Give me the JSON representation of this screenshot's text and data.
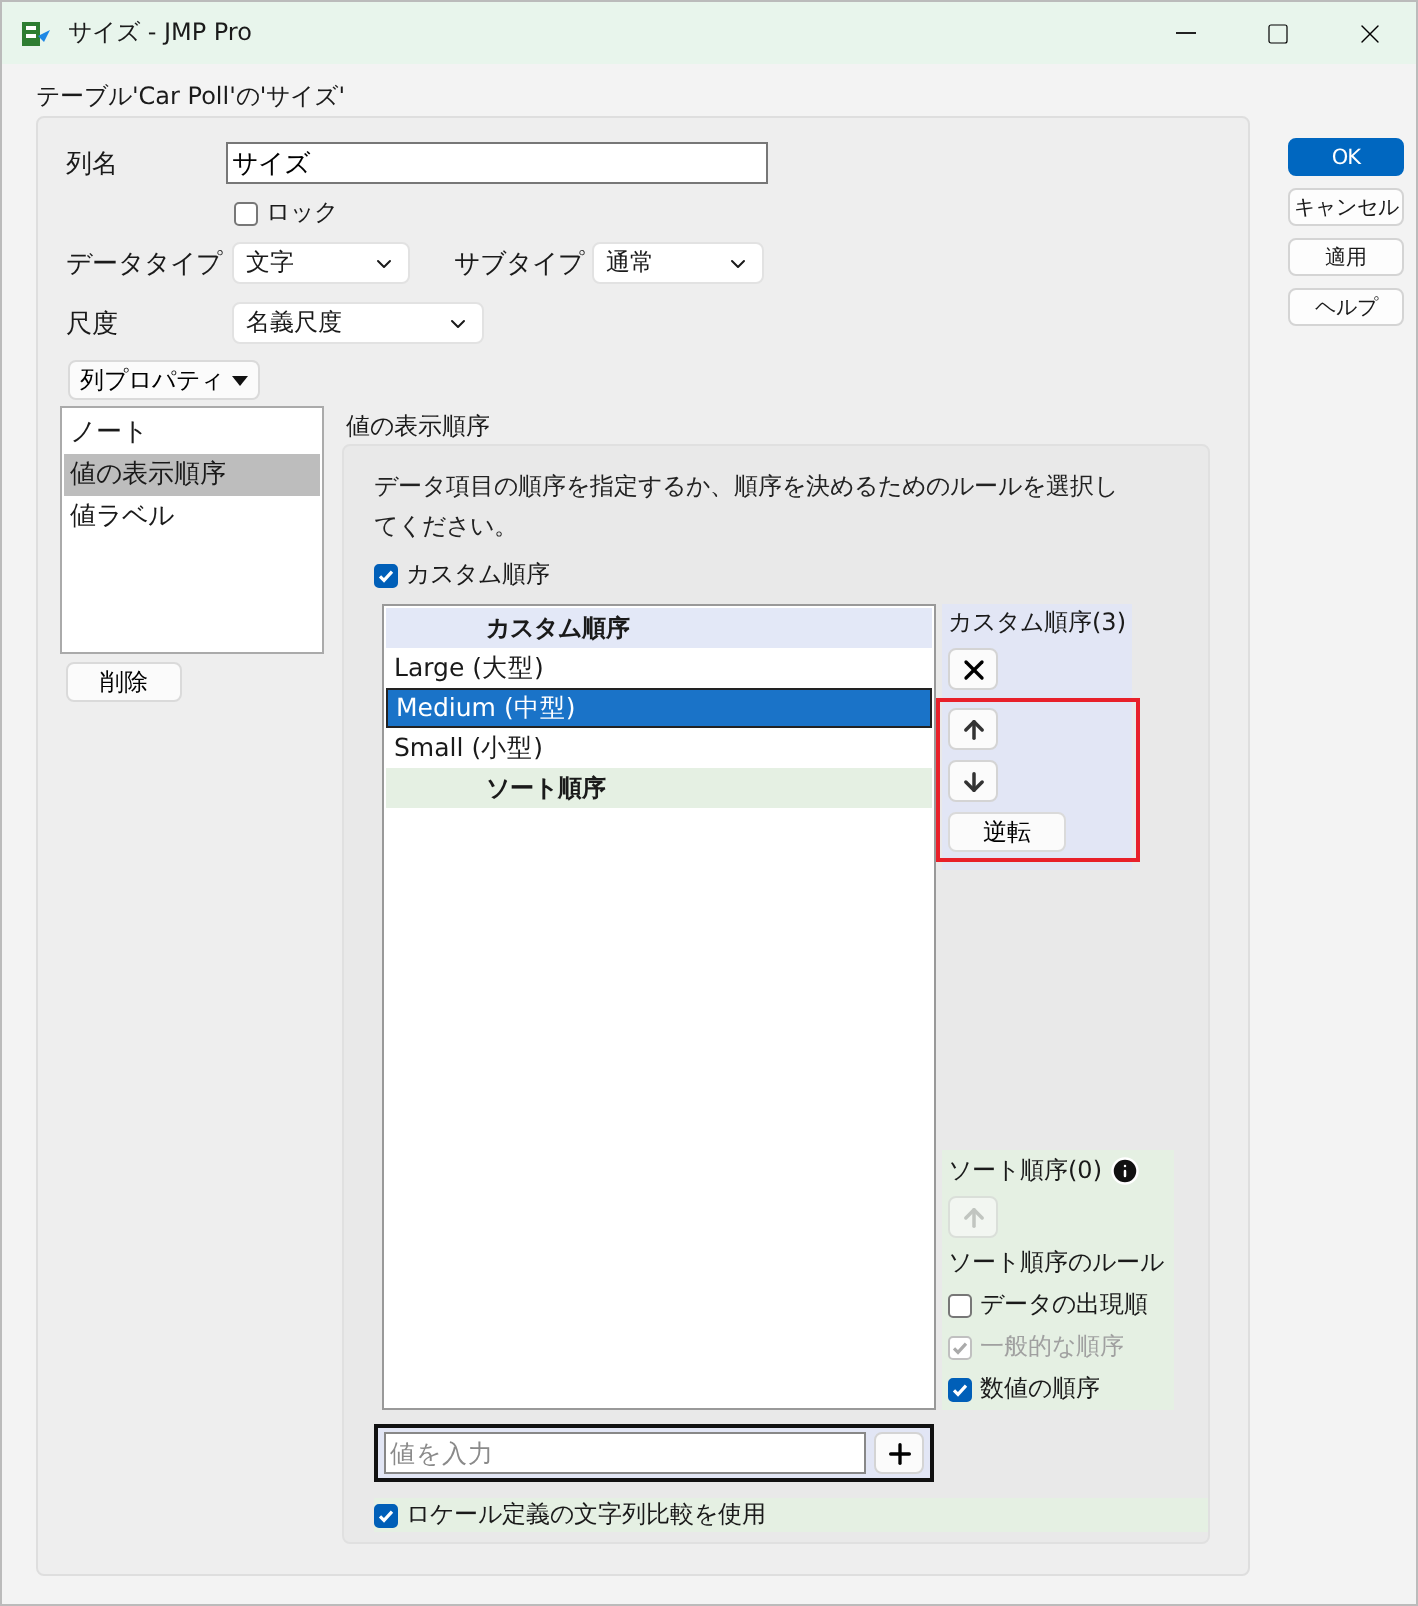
{
  "window": {
    "title": "サイズ - JMP Pro"
  },
  "caption": "テーブル'Car Poll'の'サイズ'",
  "column_name": {
    "label": "列名",
    "value": "サイズ"
  },
  "lock": {
    "label": "ロック",
    "checked": false
  },
  "data_type": {
    "label": "データタイプ",
    "value": "文字"
  },
  "subtype": {
    "label": "サブタイプ",
    "value": "通常"
  },
  "scale": {
    "label": "尺度",
    "value": "名義尺度"
  },
  "properties_menu": "列プロパティ",
  "properties": [
    {
      "label": "ノート",
      "selected": false
    },
    {
      "label": "値の表示順序",
      "selected": true
    },
    {
      "label": "値ラベル",
      "selected": false
    }
  ],
  "delete_button": "削除",
  "value_order": {
    "title": "値の表示順序",
    "description": "データ項目の順序を指定するか、順序を決めるためのルールを選択してください。",
    "custom_order": {
      "label": "カスタム順序",
      "checked": true
    },
    "list": {
      "custom_header": "カスタム順序",
      "sort_header": "ソート順序",
      "items": [
        {
          "label": "Large (大型)",
          "selected": false
        },
        {
          "label": "Medium (中型)",
          "selected": true
        },
        {
          "label": "Small (小型)",
          "selected": false
        }
      ]
    },
    "custom_panel": {
      "title": "カスタム順序(3)",
      "reverse_button": "逆転",
      "highlighted": true
    },
    "sort_panel": {
      "title": "ソート順序(0)",
      "rules_title": "ソート順序のルール",
      "rules": [
        {
          "label": "データの出現順",
          "checked": false,
          "disabled": false
        },
        {
          "label": "一般的な順序",
          "checked": true,
          "disabled": true
        },
        {
          "label": "数値の順序",
          "checked": true,
          "disabled": false
        }
      ]
    },
    "new_value": {
      "placeholder": "値を入力"
    },
    "locale_compare": {
      "label": "ロケール定義の文字列比較を使用",
      "checked": true
    }
  },
  "buttons": [
    {
      "label": "OK",
      "default": true
    },
    {
      "label": "キャンセル",
      "default": false
    },
    {
      "label": "適用",
      "default": false
    },
    {
      "label": "ヘルプ",
      "default": false
    }
  ]
}
